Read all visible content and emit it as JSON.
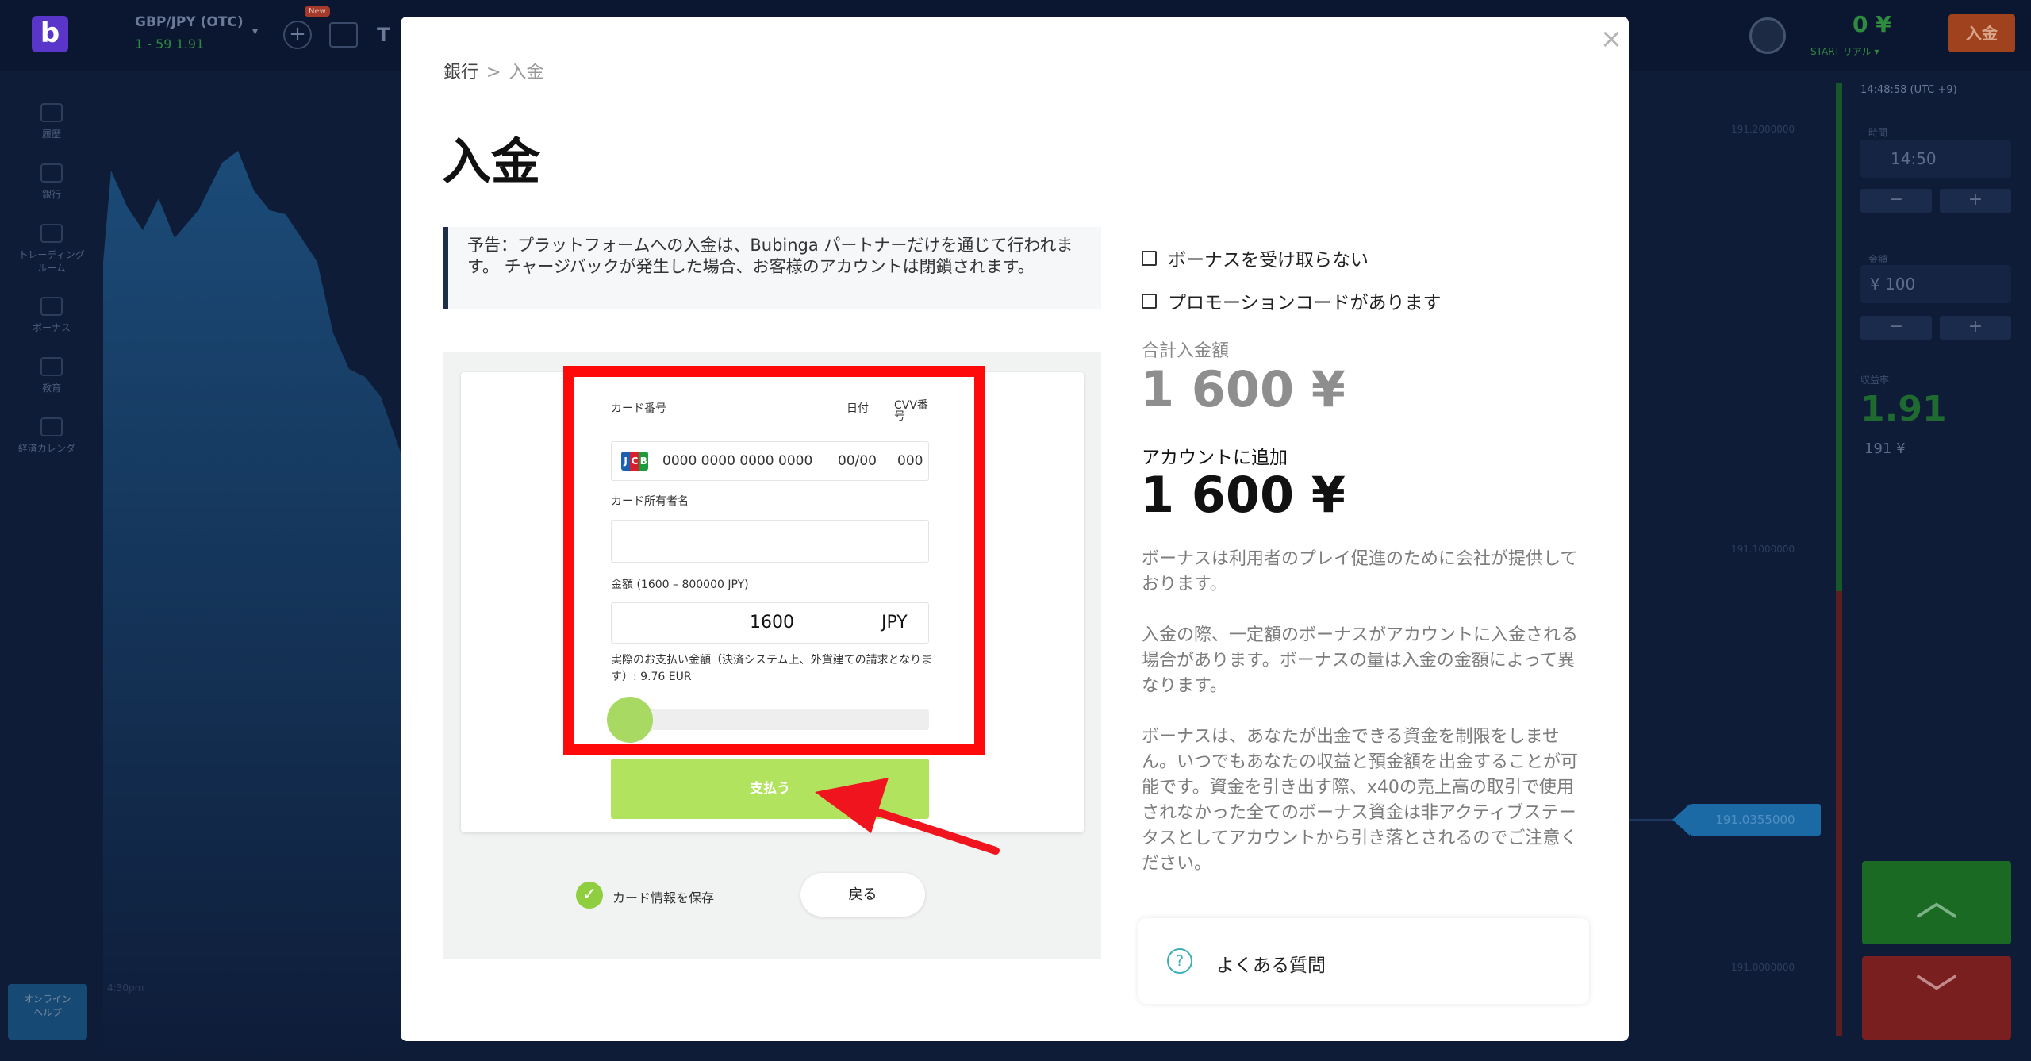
{
  "background": {
    "logo": "b",
    "asset": "GBP/JPY (OTC)",
    "asset_sub_prefix": "1 - 59",
    "asset_sub_value": "1.91",
    "new_badge": "New",
    "balance": "0 ¥",
    "balance_sub_prefix": "START",
    "balance_sub_value": "リアル ▾",
    "deposit_button": "入金",
    "sidebar": [
      {
        "label": "履歴"
      },
      {
        "label": "銀行"
      },
      {
        "label": "トレーディング\nルーム"
      },
      {
        "label": "ボーナス"
      },
      {
        "label": "教育"
      },
      {
        "label": "経済カレンダー"
      }
    ],
    "support": "オンライン\nヘルプ",
    "price_marker": "191.0355000",
    "axis": [
      "191.2000000",
      "191.1000000",
      "191.0000000"
    ],
    "time_label": "4:30pm",
    "right_panel": {
      "clock": "14:48:58 (UTC +9)",
      "time_label": "時間",
      "time_value": "14:50",
      "amount_label": "金額",
      "amount_value": "¥ 100",
      "payout_label": "収益率",
      "payout_value": "1.91",
      "payout_sub": "191 ¥",
      "minus": "−",
      "plus": "+",
      "up": "︿",
      "down": "﹀"
    }
  },
  "modal": {
    "close": "×",
    "breadcrumb": {
      "root": "銀行",
      "sep": ">",
      "current": "入金"
    },
    "title": "入金",
    "notice": "予告：プラットフォームへの入金は、Bubinga パートナーだけを通じて行われます。 チャージバックが発生した場合、お客様のアカウントは閉鎖されます。",
    "form": {
      "card_number_label": "カード番号",
      "date_label": "日付",
      "cvv_label": "CVV番号",
      "card_brand": "JCB",
      "card_number_placeholder": "0000 0000 0000 0000",
      "date_placeholder": "00/00",
      "cvv_placeholder": "000",
      "holder_label": "カード所有者名",
      "holder_value": "",
      "amount_label": "金額 (1600 – 800000 JPY)",
      "amount_value": "1600",
      "amount_currency": "JPY",
      "actual_note": "実際のお支払い金額（決済システム上、外貨建ての請求となります）: 9.76 EUR",
      "slider_position": 0,
      "pay_button": "支払う",
      "save_card": "カード情報を保存",
      "back_button": "戻る"
    },
    "options": {
      "no_bonus": "ボーナスを受け取らない",
      "promo_code": "プロモーションコードがあります"
    },
    "total_label": "合計入金額",
    "total_value": "1 600 ¥",
    "add_label": "アカウントに追加",
    "add_value": "1 600 ¥",
    "paragraphs": [
      "ボーナスは利用者のプレイ促進のために会社が提供しております。",
      "入金の際、一定額のボーナスがアカウントに入金される場合があります。ボーナスの量は入金の金額によって異なります。",
      "ボーナスは、あなたが出金できる資金を制限をしません。いつでもあなたの収益と預金額を出金することが可能です。資金を引き出す際、x40の売上高の取引で使用されなかった全てのボーナス資金は非アクティブステータスとしてアカウントから引き落とされるのでご注意ください。"
    ],
    "faq_icon": "?",
    "faq": "よくある質問"
  },
  "colors": {
    "highlight": "#ff0a0a",
    "pay_button": "#b2e35e",
    "check": "#8fce3e",
    "faq_icon": "#3cb0b4"
  }
}
